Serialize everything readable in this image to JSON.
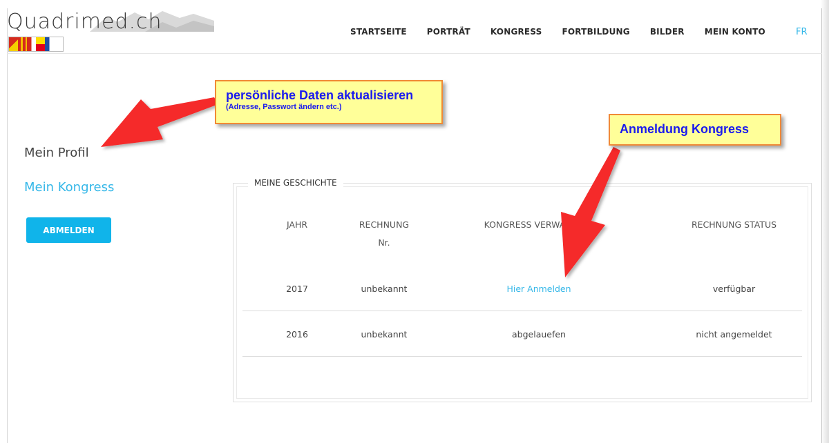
{
  "header": {
    "logo_text": "Quadrimed.ch",
    "nav": [
      "STARTSEITE",
      "PORTRÄT",
      "KONGRESS",
      "FORTBILDUNG",
      "BILDER",
      "MEIN KONTO"
    ],
    "lang": "FR"
  },
  "sidebar": {
    "profile": "Mein Profil",
    "congress": "Mein Kongress",
    "logout": "ABMELDEN"
  },
  "history": {
    "legend": "MEINE GESCHICHTE",
    "columns": {
      "year": "JAHR",
      "invoice_line1": "RECHNUNG",
      "invoice_line2": "Nr.",
      "admin": "KONGRESS VERWALTUNG",
      "status": "RECHNUNG STATUS"
    },
    "rows": [
      {
        "year": "2017",
        "invoice": "unbekannt",
        "admin": "Hier Anmelden",
        "status": "verfügbar"
      },
      {
        "year": "2016",
        "invoice": "unbekannt",
        "admin": "abgelauefen",
        "status": "nicht angemeldet"
      }
    ]
  },
  "annotations": {
    "profile_title": "persönliche Daten aktualisieren",
    "profile_sub": "(Adresse, Passwort ändern etc.)",
    "congress_title": "Anmeldung Kongress"
  },
  "colors": {
    "accent": "#34b7e8",
    "button": "#10b4ea",
    "callout_bg": "#ffff99",
    "callout_border": "#f08a36",
    "callout_text": "#1a1aee",
    "arrow": "#f52a2a"
  }
}
